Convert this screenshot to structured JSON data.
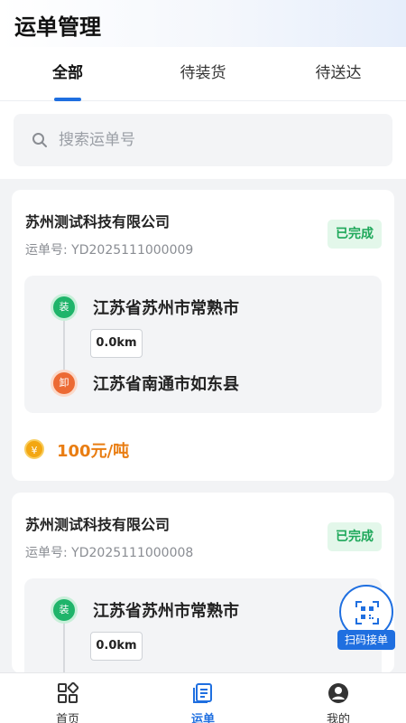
{
  "header": {
    "title": "运单管理"
  },
  "tabs": [
    {
      "label": "全部",
      "active": true
    },
    {
      "label": "待装货",
      "active": false
    },
    {
      "label": "待送达",
      "active": false
    }
  ],
  "search": {
    "placeholder": "搜索运单号",
    "value": ""
  },
  "orders": [
    {
      "company": "苏州测试科技有限公司",
      "order_no": "运单号: YD2025111000009",
      "status": "已完成",
      "load_tag": "装",
      "from": "江苏省苏州市常熟市",
      "distance": "0.0km",
      "unload_tag": "卸",
      "to": "江苏省南通市如东县",
      "price": "100元/吨",
      "coin_symbol": "¥"
    },
    {
      "company": "苏州测试科技有限公司",
      "order_no": "运单号: YD2025111000008",
      "status": "已完成",
      "load_tag": "装",
      "from": "江苏省苏州市常熟市",
      "distance": "0.0km"
    }
  ],
  "scan_button": {
    "label": "扫码接单",
    "icon": "qr-scan-icon"
  },
  "bottom_nav": [
    {
      "label": "首页",
      "icon": "home-grid-icon",
      "active": false
    },
    {
      "label": "运单",
      "icon": "waybill-list-icon",
      "active": true
    },
    {
      "label": "我的",
      "icon": "user-avatar-icon",
      "active": false
    }
  ],
  "colors": {
    "accent": "#1f6fe0",
    "status_green": "#1ea85a",
    "price_orange": "#e97d12",
    "load_green": "#1fb46a",
    "unload_orange": "#ec6a34"
  }
}
